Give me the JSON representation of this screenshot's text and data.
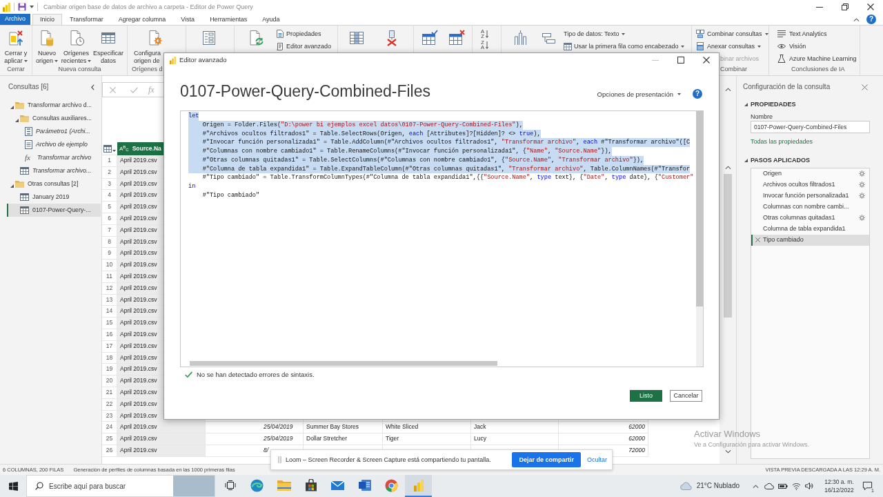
{
  "title_bar": {
    "title": "Cambiar origen base de datos de archivo a carpeta - Editor de Power Query"
  },
  "ribbon_tabs": [
    {
      "label": "Archivo",
      "kind": "backstage",
      "selected": false
    },
    {
      "label": "Inicio",
      "kind": "tab",
      "selected": true
    },
    {
      "label": "Transformar",
      "kind": "tab",
      "selected": false
    },
    {
      "label": "Agregar columna",
      "kind": "tab",
      "selected": false
    },
    {
      "label": "Vista",
      "kind": "tab",
      "selected": false
    },
    {
      "label": "Herramientas",
      "kind": "tab",
      "selected": false
    },
    {
      "label": "Ayuda",
      "kind": "tab",
      "selected": false
    }
  ],
  "ribbon_help": "?",
  "ribbon": {
    "large_groups": [
      {
        "label": "Cerrar",
        "buttons": [
          {
            "lines": [
              "Cerrar y",
              "aplicar"
            ],
            "dropdown": true
          }
        ]
      },
      {
        "label": "Nueva consulta",
        "buttons": [
          {
            "lines": [
              "Nuevo",
              "origen"
            ],
            "dropdown": true
          },
          {
            "lines": [
              "Orígenes",
              "recientes"
            ],
            "dropdown": true
          },
          {
            "lines": [
              "Especificar",
              "datos"
            ],
            "dropdown": false
          }
        ]
      },
      {
        "label": "Orígenes d",
        "buttons": [
          {
            "lines": [
              "Configura",
              "origen de"
            ],
            "dropdown": false
          }
        ]
      }
    ],
    "query_buttons": [
      {
        "label": "Propiedades",
        "dropdown": false
      },
      {
        "label": "Editor avanzado",
        "dropdown": false
      }
    ],
    "sort_glyphs": [
      "A Z",
      "Z A"
    ],
    "transform_buttons": [
      {
        "label": "Tipo de datos: Texto",
        "dropdown": true
      },
      {
        "label": "Usar la primera fila como encabezado",
        "dropdown": true
      }
    ],
    "combine_group": {
      "label": "Combinar",
      "buttons": [
        {
          "label": "Combinar consultas",
          "dropdown": true,
          "disabled": false
        },
        {
          "label": "Anexar consultas",
          "dropdown": true,
          "disabled": false
        },
        {
          "label": "binar archivos",
          "dropdown": false,
          "disabled": true
        }
      ]
    },
    "ai_group": {
      "label": "Conclusiones de IA",
      "buttons": [
        {
          "label": "Text Analytics"
        },
        {
          "label": "Visión"
        },
        {
          "label": "Azure Machine Learning"
        }
      ]
    }
  },
  "queries_panel": {
    "title": "Consultas [6]",
    "tree": [
      {
        "kind": "folder",
        "label": "Transformar archivo d...",
        "expanded": true,
        "selected": false,
        "children": [
          {
            "kind": "folder",
            "label": "Consultas auxiliares...",
            "expanded": true,
            "selected": false,
            "children": [
              {
                "kind": "parameter",
                "label": "Parámetro1 (Archi...",
                "loaded": false,
                "selected": false
              },
              {
                "kind": "list",
                "label": "Archivo de ejemplo",
                "loaded": false,
                "selected": false
              },
              {
                "kind": "function",
                "glyph": "fx",
                "label": "Transformar archivo",
                "loaded": false,
                "selected": false
              }
            ]
          },
          {
            "kind": "table",
            "label": "Transformar archivo...",
            "loaded": false,
            "selected": false
          }
        ]
      },
      {
        "kind": "folder",
        "label": "Otras consultas [2]",
        "expanded": true,
        "selected": false,
        "children": [
          {
            "kind": "table",
            "label": "January 2019",
            "loaded": true,
            "selected": false
          },
          {
            "kind": "table",
            "label": "0107-Power-Query-...",
            "loaded": true,
            "selected": true
          }
        ]
      }
    ]
  },
  "formula_bar": {
    "function_glyph": "fx"
  },
  "grid": {
    "columns": [
      {
        "label": "Source.Na",
        "type": "A$^{B}$$_{C}$",
        "selected": true
      }
    ],
    "rows": [
      {
        "number": "1",
        "cells": [
          "April 2019.csv"
        ]
      },
      {
        "number": "2",
        "cells": [
          "April 2019.csv"
        ]
      },
      {
        "number": "3",
        "cells": [
          "April 2019.csv"
        ]
      },
      {
        "number": "4",
        "cells": [
          "April 2019.csv"
        ]
      },
      {
        "number": "5",
        "cells": [
          "April 2019.csv"
        ]
      },
      {
        "number": "6",
        "cells": [
          "April 2019.csv"
        ]
      },
      {
        "number": "7",
        "cells": [
          "April 2019.csv"
        ]
      },
      {
        "number": "8",
        "cells": [
          "April 2019.csv"
        ]
      },
      {
        "number": "9",
        "cells": [
          "April 2019.csv"
        ]
      },
      {
        "number": "10",
        "cells": [
          "April 2019.csv"
        ]
      },
      {
        "number": "11",
        "cells": [
          "April 2019.csv"
        ]
      },
      {
        "number": "12",
        "cells": [
          "April 2019.csv"
        ]
      },
      {
        "number": "13",
        "cells": [
          "April 2019.csv"
        ]
      },
      {
        "number": "14",
        "cells": [
          "April 2019.csv"
        ]
      },
      {
        "number": "15",
        "cells": [
          "April 2019.csv"
        ]
      },
      {
        "number": "16",
        "cells": [
          "April 2019.csv"
        ]
      },
      {
        "number": "17",
        "cells": [
          "April 2019.csv"
        ]
      },
      {
        "number": "18",
        "cells": [
          "April 2019.csv"
        ]
      },
      {
        "number": "19",
        "cells": [
          "April 2019.csv"
        ]
      },
      {
        "number": "20",
        "cells": [
          "April 2019.csv"
        ]
      },
      {
        "number": "21",
        "cells": [
          "April 2019.csv"
        ]
      },
      {
        "number": "22",
        "cells": [
          "April 2019.csv"
        ]
      },
      {
        "number": "23",
        "cells": [
          "April 2019.csv"
        ]
      },
      {
        "number": "24",
        "cells": [
          "April 2019.csv",
          "25/04/2019",
          "Summer Bay Stores",
          "White Sliced",
          "Jack",
          "62000"
        ]
      },
      {
        "number": "25",
        "cells": [
          "April 2019.csv",
          "25/04/2019",
          "Dollar Stretcher",
          "Tiger",
          "Lucy",
          "62000"
        ]
      },
      {
        "number": "26",
        "cells": [
          "April 2019.csv",
          "8/",
          null,
          null,
          null,
          "72000"
        ]
      }
    ]
  },
  "query_settings": {
    "title": "Configuración de la consulta",
    "properties": {
      "heading": "PROPIEDADES",
      "expanded": true,
      "name_label": "Nombre",
      "name_value": "0107-Power-Query-Combined-Files",
      "link": "Todas las propiedades"
    },
    "applied_steps": {
      "heading": "PASOS APLICADOS",
      "expanded": true,
      "steps": [
        {
          "label": "Origen",
          "has_settings": true,
          "selected": false
        },
        {
          "label": "Archivos ocultos filtrados1",
          "has_settings": true,
          "selected": false
        },
        {
          "label": "Invocar función personalizada1",
          "has_settings": true,
          "selected": false
        },
        {
          "label": "Columnas con nombre cambi...",
          "has_settings": false,
          "selected": false
        },
        {
          "label": "Otras columnas quitadas1",
          "has_settings": true,
          "selected": false
        },
        {
          "label": "Columna de tabla expandida1",
          "has_settings": false,
          "selected": false
        },
        {
          "label": "Tipo cambiado",
          "has_settings": false,
          "selected": true
        }
      ]
    }
  },
  "advanced_editor": {
    "title": "Editor avanzado",
    "heading": "0107-Power-Query-Combined-Files",
    "display_options": "Opciones de presentación",
    "help": "?",
    "code": [
      {
        "selected": true,
        "tokens": [
          {
            "kind": "keyword",
            "text": "let"
          }
        ],
        "children": [
          {
            "selected": true,
            "tokens": [
              {
                "kind": "plain",
                "text": "Origen = Folder.Files("
              },
              {
                "kind": "string",
                "text": "\"D:\\power bi ejemplos excel datos\\0107-Power-Query-Combined-Files\""
              },
              {
                "kind": "plain",
                "text": "),"
              }
            ]
          },
          {
            "selected": true,
            "tokens": [
              {
                "kind": "plain",
                "text": "#\"Archivos ocultos filtrados1\" = Table.SelectRows(Origen, "
              },
              {
                "kind": "keyword",
                "text": "each"
              },
              {
                "kind": "plain",
                "text": " [Attributes]?[Hidden]? <> "
              },
              {
                "kind": "keyword",
                "text": "true"
              },
              {
                "kind": "plain",
                "text": "),"
              }
            ]
          },
          {
            "selected": true,
            "tokens": [
              {
                "kind": "plain",
                "text": "#\"Invocar función personalizada1\" = Table.AddColumn(#\"Archivos ocultos filtrados1\", "
              },
              {
                "kind": "string",
                "text": "\"Transformar archivo\""
              },
              {
                "kind": "plain",
                "text": ", "
              },
              {
                "kind": "keyword",
                "text": "each"
              },
              {
                "kind": "plain",
                "text": " #\"Transformar archivo\"([C"
              }
            ]
          },
          {
            "selected": true,
            "tokens": [
              {
                "kind": "plain",
                "text": "#\"Columnas con nombre cambiado1\" = Table.RenameColumns(#\"Invocar función personalizada1\", {"
              },
              {
                "kind": "string",
                "text": "\"Name\""
              },
              {
                "kind": "plain",
                "text": ", "
              },
              {
                "kind": "string",
                "text": "\"Source.Name\""
              },
              {
                "kind": "plain",
                "text": "}),"
              }
            ]
          },
          {
            "selected": true,
            "tokens": [
              {
                "kind": "plain",
                "text": "#\"Otras columnas quitadas1\" = Table.SelectColumns(#\"Columnas con nombre cambiado1\", {"
              },
              {
                "kind": "string",
                "text": "\"Source.Name\""
              },
              {
                "kind": "plain",
                "text": ", "
              },
              {
                "kind": "string",
                "text": "\"Transformar archivo\""
              },
              {
                "kind": "plain",
                "text": "}),"
              }
            ]
          },
          {
            "selected": true,
            "tokens": [
              {
                "kind": "plain",
                "text": "#\"Columna de tabla expandida1\" = Table.ExpandTableColumn(#\"Otras columnas quitadas1\", "
              },
              {
                "kind": "string",
                "text": "\"Transformar archivo\""
              },
              {
                "kind": "plain",
                "text": ", Table.ColumnNames(#\"Transfor"
              }
            ]
          },
          {
            "selected": false,
            "tokens": [
              {
                "kind": "plain",
                "text": "#\"Tipo cambiado\" = Table.TransformColumnTypes(#\"Columna de tabla expandida1\",{{"
              },
              {
                "kind": "string",
                "text": "\"Source.Name\""
              },
              {
                "kind": "plain",
                "text": ", "
              },
              {
                "kind": "keyword",
                "text": "type"
              },
              {
                "kind": "plain",
                "text": " text}, {"
              },
              {
                "kind": "string",
                "text": "\"Date\""
              },
              {
                "kind": "plain",
                "text": ", "
              },
              {
                "kind": "keyword",
                "text": "type"
              },
              {
                "kind": "plain",
                "text": " date}, {"
              },
              {
                "kind": "string",
                "text": "\"Customer\""
              }
            ]
          }
        ]
      },
      {
        "selected": false,
        "tokens": [
          {
            "kind": "keyword",
            "text": "in"
          }
        ],
        "children": [
          {
            "selected": false,
            "tokens": [
              {
                "kind": "plain",
                "text": "#\"Tipo cambiado\""
              }
            ]
          }
        ]
      }
    ],
    "status": "No se han detectado errores de sintaxis.",
    "buttons": [
      {
        "label": "Listo",
        "kind": "primary"
      },
      {
        "label": "Cancelar",
        "kind": "secondary"
      }
    ]
  },
  "status_bar": {
    "left": [
      "6 COLUMNAS, 200 FILAS",
      "Generación de perfiles de columnas basada en las 1000 primeras filas"
    ],
    "right": "VISTA PREVIA DESCARGADA A LAS 12:29 A. M."
  },
  "sharing_bar": {
    "message": "Loom – Screen Recorder & Screen Capture está compartiendo tu pantalla.",
    "stop_button": "Dejar de compartir",
    "hide_link": "Ocultar"
  },
  "activation_notice": {
    "title": "Activar Windows",
    "text": "Ve a Configuración para activar Windows."
  },
  "taskbar": {
    "search": {
      "placeholder": "Escribe aquí para buscar"
    },
    "apps": [
      {
        "kind": "taskview",
        "selected": false
      },
      {
        "kind": "browser",
        "selected": false
      },
      {
        "kind": "folder",
        "selected": false
      },
      {
        "kind": "store",
        "selected": false
      },
      {
        "kind": "mail",
        "selected": false
      },
      {
        "kind": "document",
        "selected": false
      },
      {
        "kind": "globe",
        "selected": false
      },
      {
        "kind": "chart",
        "selected": true
      }
    ],
    "weather": "21°C Nublado",
    "time": "12:30 a. m.",
    "date": "16/12/2022",
    "notifications": "1"
  }
}
